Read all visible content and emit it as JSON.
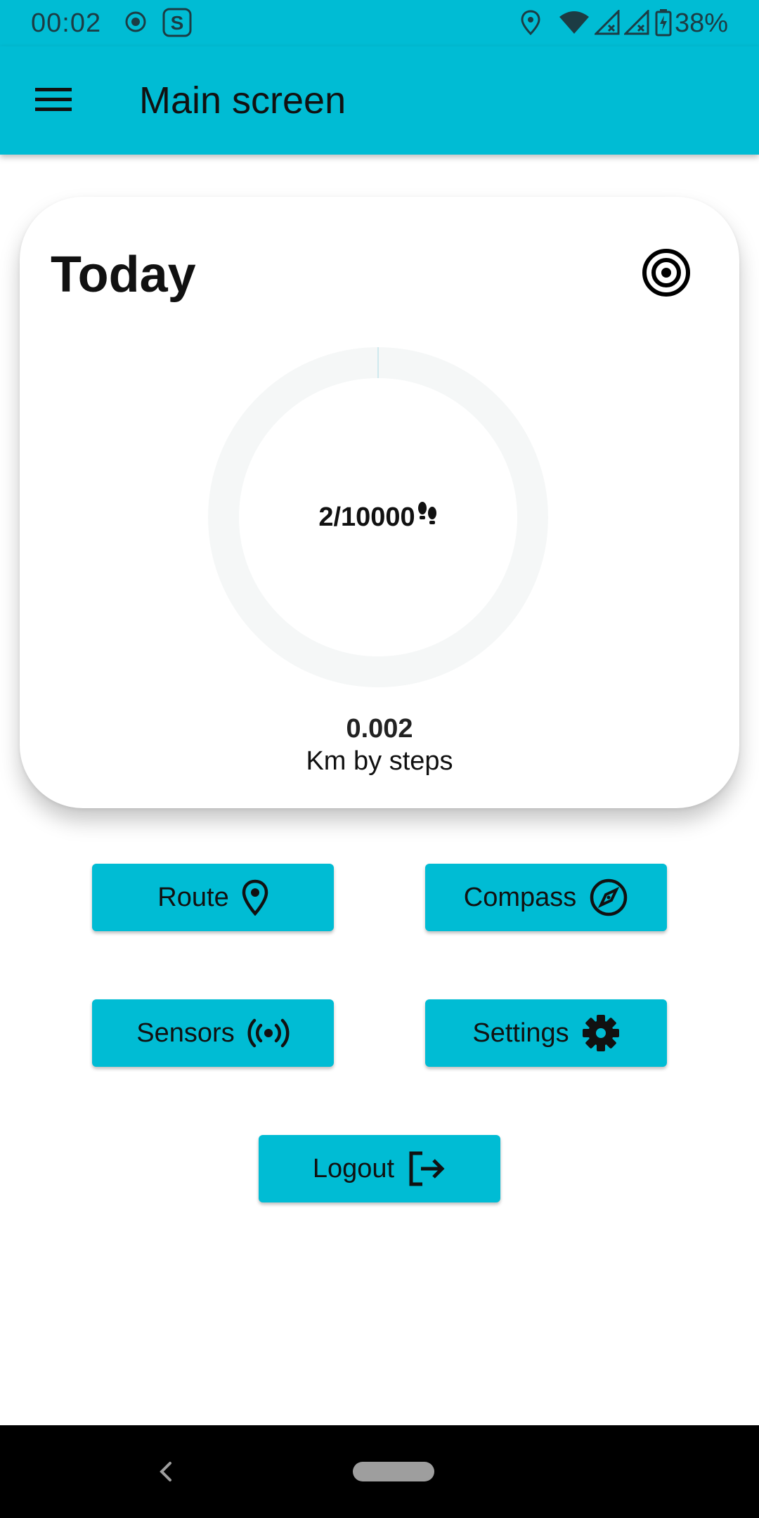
{
  "status_bar": {
    "time": "00:02",
    "battery": "38%",
    "icons": [
      "record-icon",
      "s-app-icon",
      "location-icon",
      "wifi-icon",
      "signal-icon",
      "signal-icon",
      "battery-icon"
    ]
  },
  "app_bar": {
    "title": "Main screen",
    "menu_icon": "menu-icon"
  },
  "card": {
    "title": "Today",
    "goal_icon": "target-icon",
    "steps_text": "2/10000",
    "steps_icon": "footprints-icon",
    "progress": 0.0002,
    "distance_value": "0.002",
    "distance_label": "Km by steps"
  },
  "buttons": {
    "route": {
      "label": "Route",
      "icon": "location-pin-icon"
    },
    "compass": {
      "label": "Compass",
      "icon": "compass-icon"
    },
    "sensors": {
      "label": "Sensors",
      "icon": "sensors-icon"
    },
    "settings": {
      "label": "Settings",
      "icon": "gear-icon"
    },
    "logout": {
      "label": "Logout",
      "icon": "logout-icon"
    }
  },
  "colors": {
    "primary": "#00BCD4",
    "ring_track": "#F5F7F7",
    "ring_progress": "#00BCD4"
  }
}
